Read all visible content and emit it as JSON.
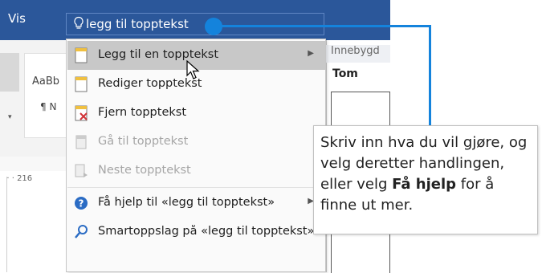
{
  "titlebar": {
    "tab_label": "Vis",
    "tellme_query": "legg til topptekst"
  },
  "ribbon": {
    "style_preview": "AaBb",
    "style_name": "¶ N",
    "ruler_label": "· · · 216"
  },
  "menu": {
    "items": [
      {
        "label": "Legg til en topptekst",
        "submenu": true,
        "disabled": false,
        "icon": "header-page-icon"
      },
      {
        "label": "Rediger topptekst",
        "submenu": false,
        "disabled": false,
        "icon": "edit-header-icon"
      },
      {
        "label": "Fjern topptekst",
        "submenu": false,
        "disabled": false,
        "icon": "remove-header-icon"
      },
      {
        "label": "Gå til topptekst",
        "submenu": false,
        "disabled": true,
        "icon": "goto-header-icon"
      },
      {
        "label": "Neste topptekst",
        "submenu": false,
        "disabled": true,
        "icon": "next-header-icon"
      },
      {
        "label": "Få hjelp til «legg til topptekst»",
        "submenu": true,
        "disabled": false,
        "icon": "help-icon"
      },
      {
        "label": "Smartoppslag på «legg til topptekst»",
        "submenu": false,
        "disabled": false,
        "icon": "smart-lookup-icon"
      }
    ]
  },
  "gallery": {
    "header": "Innebygd",
    "first_label": "Tom"
  },
  "tooltip": {
    "part1": "Skriv inn hva du vil gjøre, og velg deretter handlingen, eller velg ",
    "bold1": "Få hjelp",
    "part2": " for å finne ut mer."
  },
  "colors": {
    "titlebar": "#2b579a",
    "accent": "#1483dc",
    "highlight": "#c8c8c8"
  }
}
